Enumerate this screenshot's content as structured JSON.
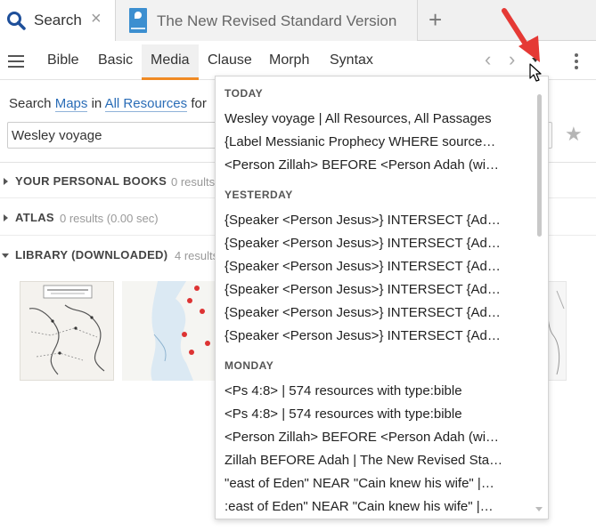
{
  "tabs": {
    "search_label": "Search",
    "search_close": "×",
    "document_label": "The New Revised Standard Version",
    "add_tab": "+"
  },
  "toolbar": {
    "modes": [
      "Bible",
      "Basic",
      "Media",
      "Clause",
      "Morph",
      "Syntax"
    ],
    "active_mode": "Media",
    "back_arrow": "‹",
    "forward_arrow": "›",
    "history_dropdown_icon": "caret-down-icon",
    "more_icon": "vertical-ellipsis-icon"
  },
  "search": {
    "prefix": "Search",
    "kind_link": "Maps",
    "in_word": "in",
    "scope_link": "All Resources",
    "for_word": "for",
    "query": "Wesley voyage",
    "favorite_icon": "star-icon"
  },
  "results": {
    "sections": [
      {
        "title": "YOUR PERSONAL BOOKS",
        "count": "0 results",
        "expanded": false
      },
      {
        "title": "ATLAS",
        "count": "0 results (0.00 sec)",
        "expanded": false
      },
      {
        "title": "LIBRARY (DOWNLOADED)",
        "count": "4 results",
        "expanded": true
      }
    ]
  },
  "history": {
    "groups": [
      {
        "label": "TODAY",
        "items": [
          "Wesley voyage | All Resources, All Passages",
          "{Label Messianic Prophecy WHERE source…",
          "<Person Zillah> BEFORE <Person Adah (wi…"
        ]
      },
      {
        "label": "YESTERDAY",
        "items": [
          "{Speaker <Person Jesus>} INTERSECT {Ad…",
          "{Speaker <Person Jesus>} INTERSECT {Ad…",
          "{Speaker <Person Jesus>} INTERSECT {Ad…",
          "{Speaker <Person Jesus>} INTERSECT {Ad…",
          "{Speaker <Person Jesus>} INTERSECT {Ad…",
          "{Speaker <Person Jesus>} INTERSECT {Ad…"
        ]
      },
      {
        "label": "MONDAY",
        "items": [
          "<Ps 4:8> | 574 resources with type:bible",
          "<Ps 4:8> | 574 resources with type:bible",
          "<Person Zillah> BEFORE <Person Adah (wi…",
          "Zillah BEFORE Adah | The New Revised Sta…",
          "\"east of Eden\" NEAR \"Cain knew his wife\" |…",
          ":east of Eden\" NEAR \"Cain knew his wife\" |…"
        ]
      }
    ]
  },
  "colors": {
    "accent_orange": "#f08a24",
    "link_blue": "#2a6db7",
    "annotation_red": "#e53935"
  }
}
